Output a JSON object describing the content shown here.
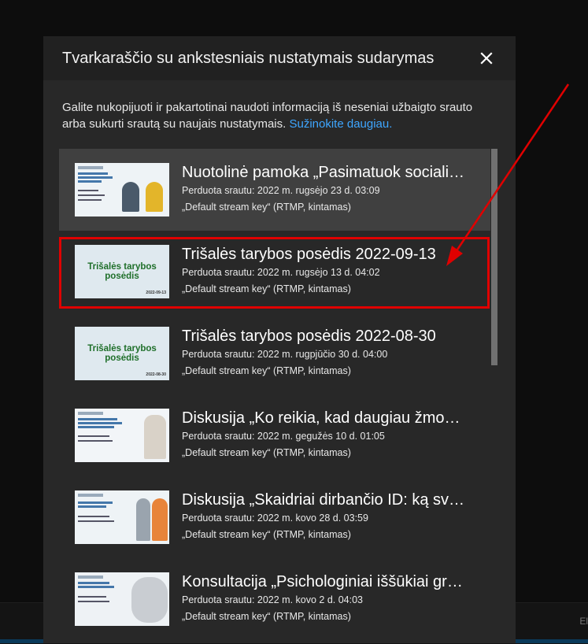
{
  "dialog": {
    "title": "Tvarkaraščio su ankstesniais nustatymais sudarymas",
    "description": "Galite nukopijuoti ir pakartotinai naudoti informaciją iš neseniai užbaigto srauto arba sukurti srautą su naujais nustatymais.",
    "learn_more": "Sužinokite daugiau.",
    "close_icon": "close-icon"
  },
  "streams": [
    {
      "title": "Nuotolinė pamoka „Pasimatuok sociali…",
      "meta": "Perduota srautu: 2022 m. rugsėjo 23 d. 03:09",
      "key": "„Default stream key“ (RTMP, kintamas)",
      "thumb_type": "lesson"
    },
    {
      "title": "Trišalės tarybos posėdis 2022-09-13",
      "meta": "Perduota srautu: 2022 m. rugsėjo 13 d. 04:02",
      "key": "„Default stream key“ (RTMP, kintamas)",
      "thumb_type": "council",
      "thumb_title": "Trišalės tarybos posėdis",
      "thumb_date": "2022-09-13"
    },
    {
      "title": "Trišalės tarybos posėdis 2022-08-30",
      "meta": "Perduota srautu: 2022 m. rugpjūčio 30 d. 04:00",
      "key": "„Default stream key“ (RTMP, kintamas)",
      "thumb_type": "council",
      "thumb_title": "Trišalės tarybos posėdis",
      "thumb_date": "2022-08-30"
    },
    {
      "title": "Diskusija „Ko reikia, kad daugiau žmo…",
      "meta": "Perduota srautu: 2022 m. gegužės 10 d. 01:05",
      "key": "„Default stream key“ (RTMP, kintamas)",
      "thumb_type": "discussion"
    },
    {
      "title": "Diskusija „Skaidriai dirbančio ID: ką sv…",
      "meta": "Perduota srautu: 2022 m. kovo 28 d. 03:59",
      "key": "„Default stream key“ (RTMP, kintamas)",
      "thumb_type": "discussion2"
    },
    {
      "title": "Konsultacija „Psichologiniai iššūkiai gr…",
      "meta": "Perduota srautu: 2022 m. kovo 2 d. 04:03",
      "key": "„Default stream key“ (RTMP, kintamas)",
      "thumb_type": "consult"
    }
  ],
  "colors": {
    "accent_link": "#3ea6ff",
    "highlight": "#e00000"
  }
}
